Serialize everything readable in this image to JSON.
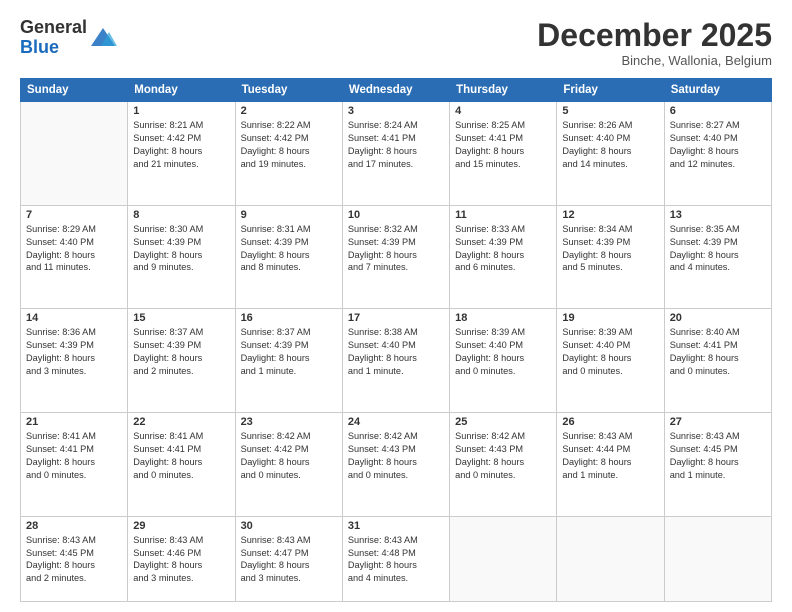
{
  "logo": {
    "general": "General",
    "blue": "Blue"
  },
  "header": {
    "month": "December 2025",
    "location": "Binche, Wallonia, Belgium"
  },
  "weekdays": [
    "Sunday",
    "Monday",
    "Tuesday",
    "Wednesday",
    "Thursday",
    "Friday",
    "Saturday"
  ],
  "weeks": [
    [
      {
        "day": "",
        "info": ""
      },
      {
        "day": "1",
        "info": "Sunrise: 8:21 AM\nSunset: 4:42 PM\nDaylight: 8 hours\nand 21 minutes."
      },
      {
        "day": "2",
        "info": "Sunrise: 8:22 AM\nSunset: 4:42 PM\nDaylight: 8 hours\nand 19 minutes."
      },
      {
        "day": "3",
        "info": "Sunrise: 8:24 AM\nSunset: 4:41 PM\nDaylight: 8 hours\nand 17 minutes."
      },
      {
        "day": "4",
        "info": "Sunrise: 8:25 AM\nSunset: 4:41 PM\nDaylight: 8 hours\nand 15 minutes."
      },
      {
        "day": "5",
        "info": "Sunrise: 8:26 AM\nSunset: 4:40 PM\nDaylight: 8 hours\nand 14 minutes."
      },
      {
        "day": "6",
        "info": "Sunrise: 8:27 AM\nSunset: 4:40 PM\nDaylight: 8 hours\nand 12 minutes."
      }
    ],
    [
      {
        "day": "7",
        "info": "Sunrise: 8:29 AM\nSunset: 4:40 PM\nDaylight: 8 hours\nand 11 minutes."
      },
      {
        "day": "8",
        "info": "Sunrise: 8:30 AM\nSunset: 4:39 PM\nDaylight: 8 hours\nand 9 minutes."
      },
      {
        "day": "9",
        "info": "Sunrise: 8:31 AM\nSunset: 4:39 PM\nDaylight: 8 hours\nand 8 minutes."
      },
      {
        "day": "10",
        "info": "Sunrise: 8:32 AM\nSunset: 4:39 PM\nDaylight: 8 hours\nand 7 minutes."
      },
      {
        "day": "11",
        "info": "Sunrise: 8:33 AM\nSunset: 4:39 PM\nDaylight: 8 hours\nand 6 minutes."
      },
      {
        "day": "12",
        "info": "Sunrise: 8:34 AM\nSunset: 4:39 PM\nDaylight: 8 hours\nand 5 minutes."
      },
      {
        "day": "13",
        "info": "Sunrise: 8:35 AM\nSunset: 4:39 PM\nDaylight: 8 hours\nand 4 minutes."
      }
    ],
    [
      {
        "day": "14",
        "info": "Sunrise: 8:36 AM\nSunset: 4:39 PM\nDaylight: 8 hours\nand 3 minutes."
      },
      {
        "day": "15",
        "info": "Sunrise: 8:37 AM\nSunset: 4:39 PM\nDaylight: 8 hours\nand 2 minutes."
      },
      {
        "day": "16",
        "info": "Sunrise: 8:37 AM\nSunset: 4:39 PM\nDaylight: 8 hours\nand 1 minute."
      },
      {
        "day": "17",
        "info": "Sunrise: 8:38 AM\nSunset: 4:40 PM\nDaylight: 8 hours\nand 1 minute."
      },
      {
        "day": "18",
        "info": "Sunrise: 8:39 AM\nSunset: 4:40 PM\nDaylight: 8 hours\nand 0 minutes."
      },
      {
        "day": "19",
        "info": "Sunrise: 8:39 AM\nSunset: 4:40 PM\nDaylight: 8 hours\nand 0 minutes."
      },
      {
        "day": "20",
        "info": "Sunrise: 8:40 AM\nSunset: 4:41 PM\nDaylight: 8 hours\nand 0 minutes."
      }
    ],
    [
      {
        "day": "21",
        "info": "Sunrise: 8:41 AM\nSunset: 4:41 PM\nDaylight: 8 hours\nand 0 minutes."
      },
      {
        "day": "22",
        "info": "Sunrise: 8:41 AM\nSunset: 4:41 PM\nDaylight: 8 hours\nand 0 minutes."
      },
      {
        "day": "23",
        "info": "Sunrise: 8:42 AM\nSunset: 4:42 PM\nDaylight: 8 hours\nand 0 minutes."
      },
      {
        "day": "24",
        "info": "Sunrise: 8:42 AM\nSunset: 4:43 PM\nDaylight: 8 hours\nand 0 minutes."
      },
      {
        "day": "25",
        "info": "Sunrise: 8:42 AM\nSunset: 4:43 PM\nDaylight: 8 hours\nand 0 minutes."
      },
      {
        "day": "26",
        "info": "Sunrise: 8:43 AM\nSunset: 4:44 PM\nDaylight: 8 hours\nand 1 minute."
      },
      {
        "day": "27",
        "info": "Sunrise: 8:43 AM\nSunset: 4:45 PM\nDaylight: 8 hours\nand 1 minute."
      }
    ],
    [
      {
        "day": "28",
        "info": "Sunrise: 8:43 AM\nSunset: 4:45 PM\nDaylight: 8 hours\nand 2 minutes."
      },
      {
        "day": "29",
        "info": "Sunrise: 8:43 AM\nSunset: 4:46 PM\nDaylight: 8 hours\nand 3 minutes."
      },
      {
        "day": "30",
        "info": "Sunrise: 8:43 AM\nSunset: 4:47 PM\nDaylight: 8 hours\nand 3 minutes."
      },
      {
        "day": "31",
        "info": "Sunrise: 8:43 AM\nSunset: 4:48 PM\nDaylight: 8 hours\nand 4 minutes."
      },
      {
        "day": "",
        "info": ""
      },
      {
        "day": "",
        "info": ""
      },
      {
        "day": "",
        "info": ""
      }
    ]
  ]
}
